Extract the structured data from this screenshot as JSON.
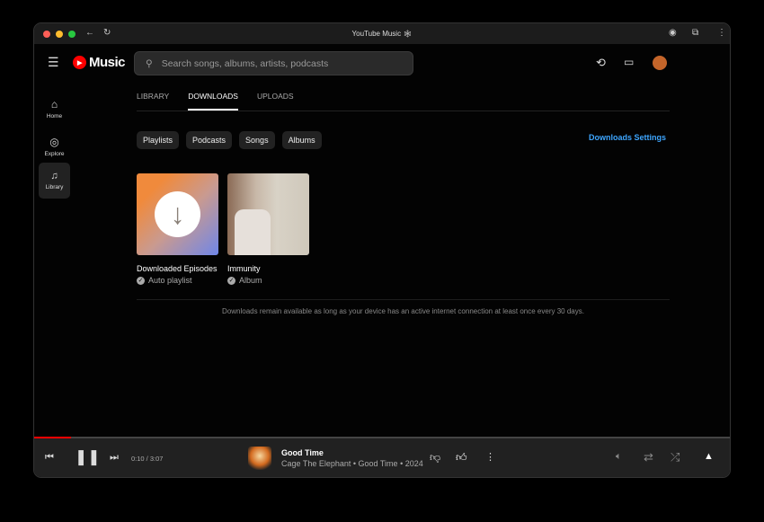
{
  "window": {
    "title": "YouTube Music 🕸"
  },
  "header": {
    "logo": "Music",
    "search_placeholder": "Search songs, albums, artists, podcasts"
  },
  "sidebar": {
    "items": [
      {
        "label": "Home"
      },
      {
        "label": "Explore"
      },
      {
        "label": "Library",
        "active": true
      }
    ]
  },
  "tabs": [
    {
      "label": "LIBRARY"
    },
    {
      "label": "DOWNLOADS",
      "active": true
    },
    {
      "label": "UPLOADS"
    }
  ],
  "chips": [
    "Playlists",
    "Podcasts",
    "Songs",
    "Albums"
  ],
  "downloads_settings": "Downloads Settings",
  "cards": [
    {
      "title": "Downloaded Episodes",
      "subtitle": "Auto playlist"
    },
    {
      "title": "Immunity",
      "subtitle": "Album"
    }
  ],
  "note": "Downloads remain available as long as your device has an active internet connection at least once every 30 days.",
  "player": {
    "time": "0:10 / 3:07",
    "progress_percent": 5.3,
    "title": "Good Time",
    "subtitle": "Cage The Elephant • Good Time • 2024"
  },
  "colors": {
    "accent": "#ff0000",
    "link": "#3ea6ff"
  }
}
